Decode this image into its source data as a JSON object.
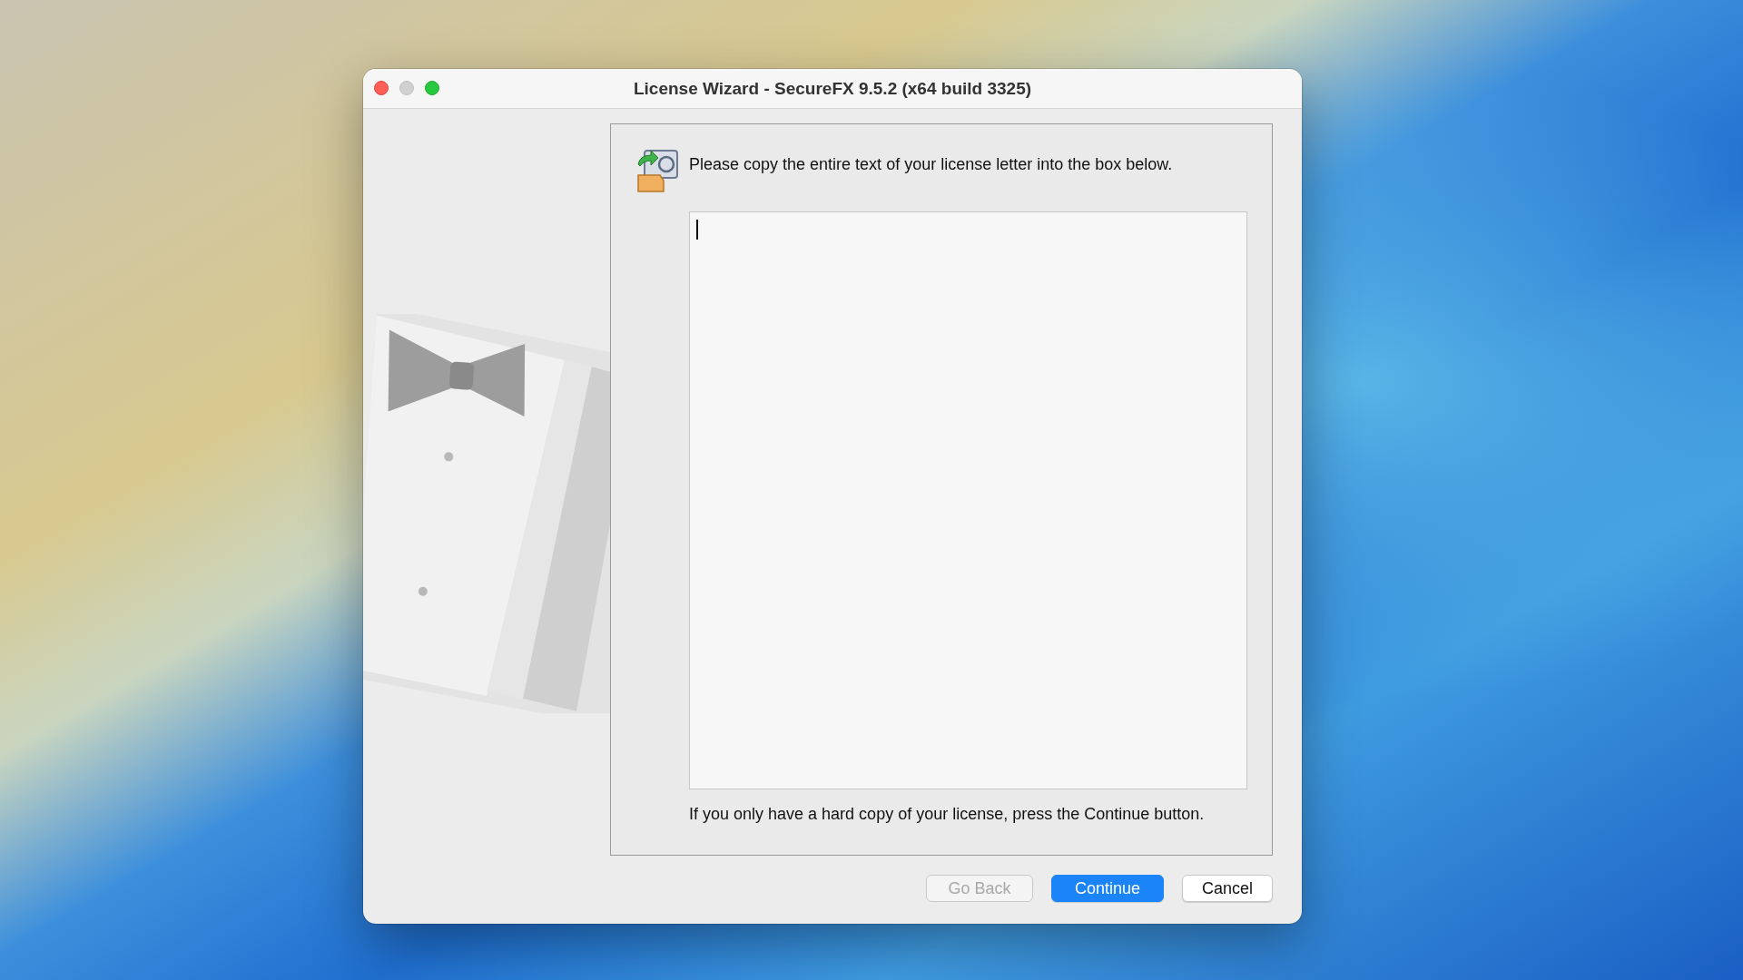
{
  "window": {
    "title": "License Wizard - SecureFX 9.5.2 (x64 build 3325)",
    "controls": [
      {
        "kind": "close",
        "disabled": false
      },
      {
        "kind": "minimize",
        "disabled": true
      },
      {
        "kind": "zoom",
        "disabled": false
      }
    ]
  },
  "instruction": "Please copy the entire text of your license letter into the box below.",
  "license_box": {
    "focused": true
  },
  "note": "If you only have a hard copy of your license, press the Continue button.",
  "buttons": [
    {
      "label": "Go Back",
      "kind": "secondary",
      "disabled": true
    },
    {
      "label": "Continue",
      "kind": "default",
      "disabled": false
    },
    {
      "label": "Cancel",
      "kind": "secondary",
      "disabled": false
    }
  ]
}
